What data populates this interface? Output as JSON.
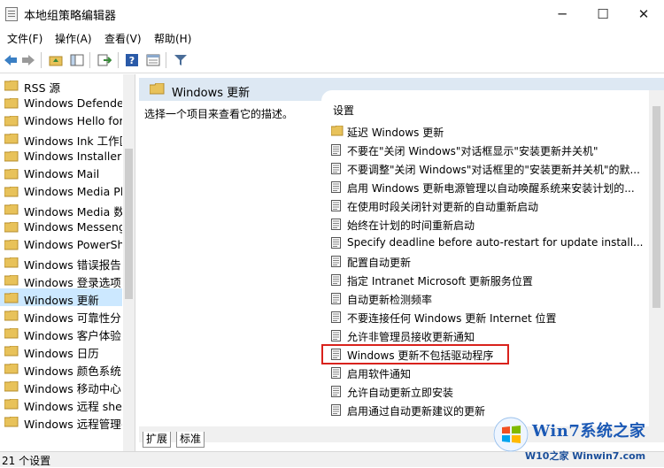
{
  "window": {
    "title": "本地组策略编辑器",
    "minimize": "─",
    "maximize": "☐",
    "close": "✕"
  },
  "menu": [
    "文件(F)",
    "操作(A)",
    "查看(V)",
    "帮助(H)"
  ],
  "toolbar_icons": [
    "back-icon",
    "forward-icon",
    "up-folder-icon",
    "show-hide-tree-icon",
    "export-icon",
    "help-icon",
    "properties-icon",
    "filter-icon"
  ],
  "tree": {
    "items": [
      "RSS 源",
      "Windows Defender",
      "Windows Hello for",
      "Windows Ink 工作区",
      "Windows Installer",
      "Windows Mail",
      "Windows Media Pl",
      "Windows Media 数",
      "Windows Messeng",
      "Windows PowerSh",
      "Windows 错误报告",
      "Windows 登录选项",
      "Windows 更新",
      "Windows 可靠性分",
      "Windows 客户体验",
      "Windows 日历",
      "Windows 颜色系统",
      "Windows 移动中心",
      "Windows 远程 shel",
      "Windows 远程管理("
    ],
    "selected_index": 12
  },
  "detail": {
    "header": "Windows 更新",
    "description": "选择一个项目来查看它的描述。",
    "column_header": "设置",
    "rows": [
      {
        "type": "folder",
        "text": "延迟 Windows 更新"
      },
      {
        "type": "policy",
        "text": "不要在\"关闭 Windows\"对话框显示\"安装更新并关机\""
      },
      {
        "type": "policy",
        "text": "不要调整\"关闭 Windows\"对话框里的\"安装更新并关机\"的默..."
      },
      {
        "type": "policy",
        "text": "启用 Windows 更新电源管理以自动唤醒系统来安装计划的..."
      },
      {
        "type": "policy",
        "text": "在使用时段关闭针对更新的自动重新启动"
      },
      {
        "type": "policy",
        "text": "始终在计划的时间重新启动"
      },
      {
        "type": "policy",
        "text": "Specify deadline before auto-restart for update install..."
      },
      {
        "type": "policy",
        "text": "配置自动更新"
      },
      {
        "type": "policy",
        "text": "指定 Intranet Microsoft 更新服务位置"
      },
      {
        "type": "policy",
        "text": "自动更新检测频率"
      },
      {
        "type": "policy",
        "text": "不要连接任何 Windows 更新 Internet 位置"
      },
      {
        "type": "policy",
        "text": "允许非管理员接收更新通知"
      },
      {
        "type": "policy",
        "text": "Windows 更新不包括驱动程序"
      },
      {
        "type": "policy",
        "text": "启用软件通知"
      },
      {
        "type": "policy",
        "text": "允许自动更新立即安装"
      },
      {
        "type": "policy",
        "text": "启用通过自动更新建议的更新"
      }
    ],
    "highlighted_index": 12
  },
  "tabs": [
    "扩展",
    "标准"
  ],
  "status": "21 个设置",
  "watermark": {
    "brand": "Win7系统之家",
    "url": "W10之家 Winwin7.com"
  },
  "colors": {
    "folder": "#e8c25a",
    "selection": "#cce8ff",
    "header_bg": "#dde8f3",
    "highlight_border": "#d9221c"
  }
}
